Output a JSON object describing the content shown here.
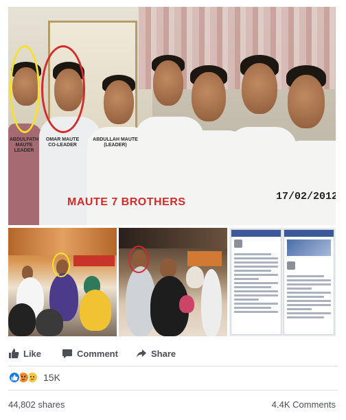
{
  "post": {
    "main_photo": {
      "labels": {
        "person1": "ABDULFATH\nMAUTE\nLEADER",
        "person2": "OMAR MAUTE\nCO-LEADER",
        "person3": "ABDULLAH MAUTE\n(LEADER)"
      },
      "caption": "MAUTE 7 BROTHERS",
      "date_stamp": "17/02/2012"
    },
    "thumbnails": [
      "group-photo-restaurant",
      "family-photo-mall",
      "facebook-screenshot"
    ]
  },
  "actions": {
    "like_label": "Like",
    "comment_label": "Comment",
    "share_label": "Share"
  },
  "reactions": {
    "types": [
      "like",
      "angry",
      "sad"
    ],
    "count": "15K"
  },
  "stats": {
    "shares": "44,802 shares",
    "comments": "4.4K Comments"
  },
  "colors": {
    "like_blue": "#1877f2",
    "angry_orange": "#f0892c",
    "sad_yellow": "#f7c43c",
    "text_gray": "#4b4f56",
    "highlight_red": "#d62a28",
    "highlight_yellow": "#f5e12a"
  }
}
